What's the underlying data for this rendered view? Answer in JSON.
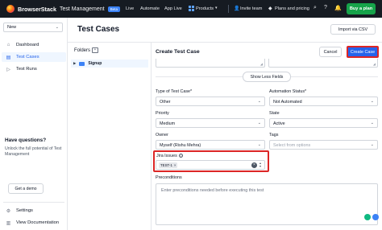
{
  "topbar": {
    "brand": "BrowserStack",
    "product": "Test Management",
    "badge": "Beta",
    "nav": [
      "Live",
      "Automate",
      "App Live",
      "Products"
    ],
    "invite": "Invite team",
    "plans": "Plans and pricing",
    "buy": "Buy a plan",
    "icons": [
      "search-icon",
      "help-icon",
      "bell-icon",
      "settings-icon",
      "user-icon"
    ]
  },
  "sidebar": {
    "project": "New",
    "items": [
      {
        "label": "Dashboard",
        "icon": "home-icon"
      },
      {
        "label": "Test Cases",
        "icon": "document-icon",
        "active": true
      },
      {
        "label": "Test Runs",
        "icon": "play-icon"
      }
    ],
    "help": {
      "title": "Have questions?",
      "text": "Unlock the full potential of Test Management",
      "button": "Get a demo"
    },
    "bottom": [
      {
        "label": "Settings",
        "icon": "gear-icon"
      },
      {
        "label": "View Documentation",
        "icon": "book-icon"
      }
    ]
  },
  "main": {
    "title": "Test Cases",
    "import": "Import via CSV",
    "folders_label": "Folders",
    "folder": "Signup"
  },
  "form": {
    "title": "Create Test Case",
    "cancel": "Cancel",
    "create": "Create Case",
    "toggle": "Show Less Fields",
    "type_label": "Type of Test Case*",
    "type_value": "Other",
    "automation_label": "Automation Status*",
    "automation_value": "Not Automated",
    "priority_label": "Priority",
    "priority_value": "Medium",
    "state_label": "State",
    "state_value": "Active",
    "owner_label": "Owner",
    "owner_value": "Myself (Rishu Mehra)",
    "tags_label": "Tags",
    "tags_placeholder": "Select from options",
    "jira_label": "Jira Issues",
    "jira_chip": "TEST-1",
    "precond_label": "Preconditions",
    "precond_placeholder": "Enter preconditions needed before executing this test"
  }
}
